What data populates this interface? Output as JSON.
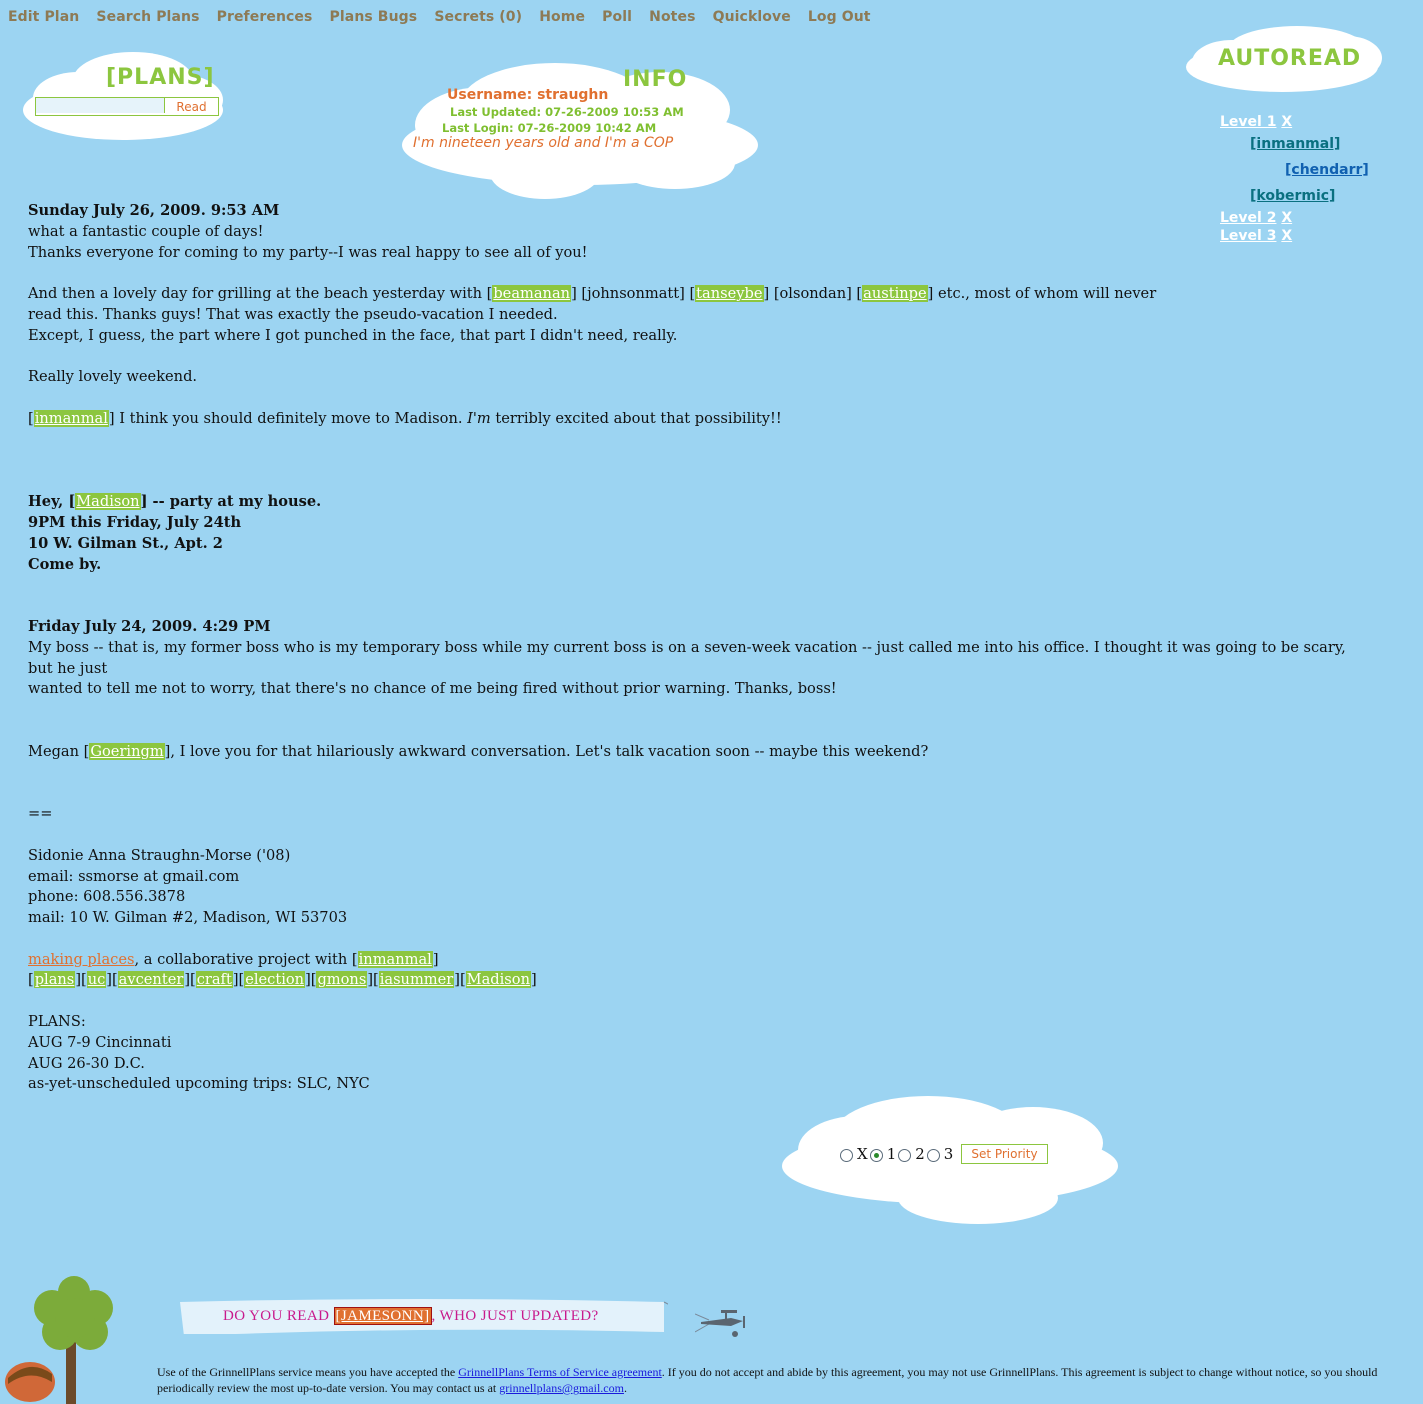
{
  "nav": [
    "Edit Plan",
    "Search Plans",
    "Preferences",
    "Plans Bugs",
    "Secrets (0)",
    "Home",
    "Poll",
    "Notes",
    "Quicklove",
    "Log Out"
  ],
  "plans_box": {
    "title": "[PLANS]",
    "search_value": "",
    "button": "Read"
  },
  "info": {
    "title": "INFO",
    "username": "Username: straughn",
    "last_updated": "Last Updated: 07-26-2009 10:53 AM",
    "last_login": "Last Login: 07-26-2009 10:42 AM",
    "tagline": "I'm nineteen years old and I'm a COP"
  },
  "autoread": {
    "title": "AUTOREAD",
    "level1": "Level 1",
    "level2": "Level 2",
    "level3": "Level 3",
    "clear": "X",
    "users": [
      "[inmanmal]",
      "[chendarr]",
      "[kobermic]"
    ]
  },
  "plan": {
    "entry1_date": "Sunday July 26, 2009. 9:53 AM",
    "e1_l1": "what a fantastic couple of days!",
    "e1_l2": "Thanks everyone for coming to my party--I was real happy to see all of you!",
    "e1_l3a": "And then a lovely day for grilling at the beach yesterday with [",
    "link_beamanan": "beamanan",
    "e1_l3b": "] [johnsonmatt] [",
    "link_tanseybe": "tanseybe",
    "e1_l3c": "] [olsondan] [",
    "link_austinpe": "austinpe",
    "e1_l3d": "] etc., most of whom will never",
    "e1_l4": "read this. Thanks guys! That was exactly the pseudo-vacation I needed.",
    "e1_l5": "Except, I guess, the part where I got punched in the face, that part I didn't need, really.",
    "e1_l6": "Really lovely weekend.",
    "e1_l7a": "[",
    "link_inmanmal": "inmanmal",
    "e1_l7b": "] I think you should definitely move to Madison. ",
    "e1_l7em": "I'm",
    "e1_l7c": " terribly excited about that possibility!!",
    "party_a": "Hey, [",
    "link_madison": "Madison",
    "party_b": "] -- party at my house.",
    "party_2": "9PM this Friday, July 24th",
    "party_3": "10 W. Gilman St., Apt. 2",
    "party_4": "Come by.",
    "entry2_date": "Friday July 24, 2009. 4:29 PM",
    "e2_l1": "My boss -- that is, my former boss who is my temporary boss while my current boss is on a seven-week vacation -- just called me into his office. I thought it was going to be scary, but he just",
    "e2_l2": "wanted to tell me not to worry, that there's no chance of me being fired without prior warning. Thanks, boss!",
    "e2_l3a": "Megan [",
    "link_goeringm": "Goeringm",
    "e2_l3b": "], I love you for that hilariously awkward conversation. Let's talk vacation soon -- maybe this weekend?",
    "sep": "==",
    "sig_name": "Sidonie Anna Straughn-Morse ('08)",
    "sig_email": "email: ssmorse at gmail.com",
    "sig_phone": "phone: 608.556.3878",
    "sig_mail": "mail: 10 W. Gilman #2, Madison, WI 53703",
    "making_places": "making places",
    "collab": ", a collaborative project with [",
    "link_inmanmal2": "inmanmal",
    "collab_end": "]",
    "tags": [
      "plans",
      "uc",
      "avcenter",
      "craft",
      "election",
      "gmons",
      "iasummer",
      "Madison"
    ],
    "plans_head": "PLANS:",
    "plans_1": "AUG 7-9 Cincinnati",
    "plans_2": "AUG 26-30 D.C.",
    "plans_3": "as-yet-unscheduled upcoming trips: SLC, NYC"
  },
  "priority": {
    "options": [
      "X",
      "1",
      "2",
      "3"
    ],
    "selected": "1",
    "button": "Set Priority"
  },
  "banner": {
    "pre": "DO YOU READ ",
    "user": "[JAMESONN]",
    "post": ", WHO JUST UPDATED?"
  },
  "legal": {
    "a": "Use of the GrinnellPlans service means you have accepted the ",
    "tos_link": "GrinnellPlans Terms of Service agreement",
    "b": ". If you do not accept and abide by this agreement, you may not use GrinnellPlans. This agreement is subject to change without notice, so you should periodically review the most up-to-date version. You may contact us at ",
    "email_link": "grinnellplans@gmail.com",
    "c": "."
  },
  "colors": {
    "background": "#9cd4f2",
    "green": "#8cc63f",
    "orange": "#e07030",
    "nav": "#8d7a55"
  }
}
